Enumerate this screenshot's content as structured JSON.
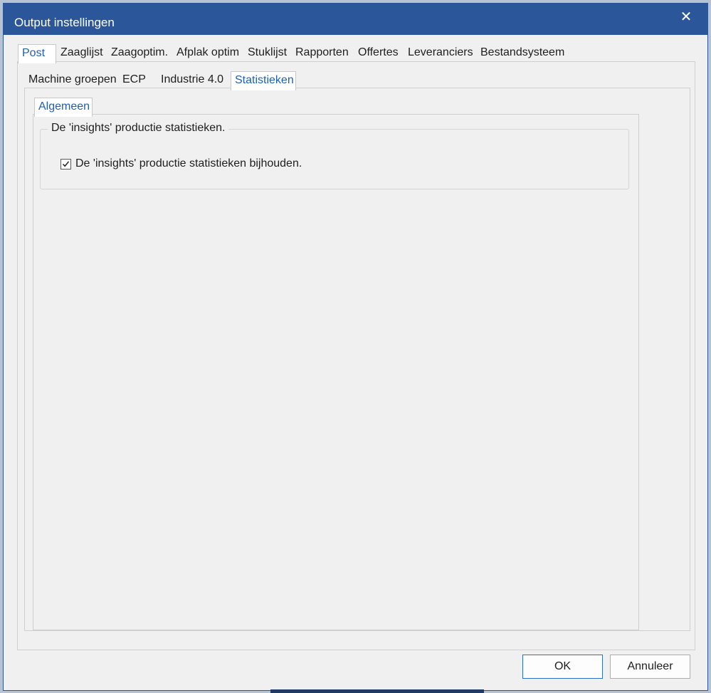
{
  "window": {
    "title": "Output instellingen",
    "close_icon": "close-icon"
  },
  "main_tabs": [
    {
      "label": "Post",
      "active": true
    },
    {
      "label": "Zaaglijst",
      "active": false
    },
    {
      "label": "Zaagoptim.",
      "active": false
    },
    {
      "label": "Afplak optim",
      "active": false
    },
    {
      "label": "Stuklijst",
      "active": false
    },
    {
      "label": "Rapporten",
      "active": false
    },
    {
      "label": "Offertes",
      "active": false
    },
    {
      "label": "Leveranciers",
      "active": false
    },
    {
      "label": "Bestandsysteem",
      "active": false
    }
  ],
  "sub_tabs": [
    {
      "label": "Machine groepen",
      "active": false
    },
    {
      "label": "ECP",
      "active": false
    },
    {
      "label": "Industrie 4.0",
      "active": false
    },
    {
      "label": "Statistieken",
      "active": true
    }
  ],
  "inner_tabs": [
    {
      "label": "Algemeen",
      "active": true
    }
  ],
  "group": {
    "title": "De 'insights' productie statistieken.",
    "checkbox_label": "De 'insights' productie statistieken bijhouden.",
    "checked": true
  },
  "buttons": {
    "ok": "OK",
    "cancel": "Annuleer"
  },
  "colors": {
    "titlebar": "#2b579a",
    "active_tab_text": "#1f5fb0",
    "background": "#f0f0f0"
  }
}
